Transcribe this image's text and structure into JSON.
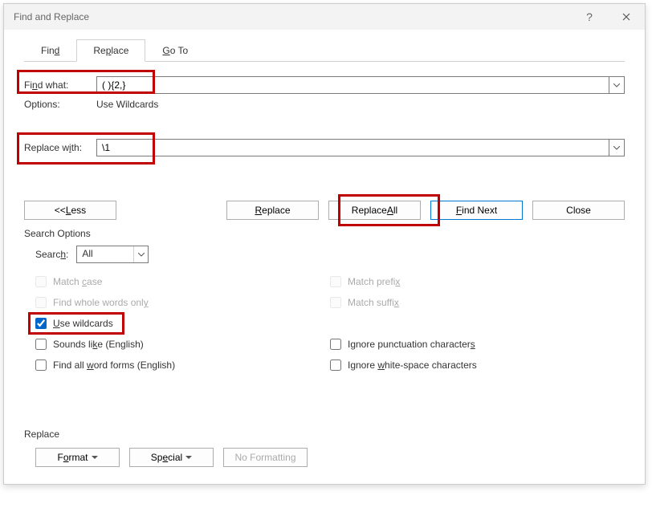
{
  "titlebar": {
    "title": "Find and Replace"
  },
  "tabs": {
    "find": "Find",
    "replace": "Replace",
    "goto": "Go To"
  },
  "labels": {
    "find_what": "Find what:",
    "options": "Options:",
    "options_value": "Use Wildcards",
    "replace_with": "Replace with:"
  },
  "fields": {
    "find_value": "( ){2,}",
    "replace_value": "\\1"
  },
  "buttons": {
    "less": "<< Less",
    "replace": "Replace",
    "replace_all": "Replace All",
    "find_next": "Find Next",
    "close": "Close",
    "format": "Format",
    "special": "Special",
    "no_formatting": "No Formatting"
  },
  "search_options": {
    "legend": "Search Options",
    "search_label": "Search:",
    "search_value": "All",
    "match_case": "Match case",
    "whole_words": "Find whole words only",
    "use_wildcards": "Use wildcards",
    "sounds_like": "Sounds like (English)",
    "all_word_forms": "Find all word forms (English)",
    "match_prefix": "Match prefix",
    "match_suffix": "Match suffix",
    "ignore_punct": "Ignore punctuation characters",
    "ignore_ws": "Ignore white-space characters"
  },
  "bottom": {
    "legend": "Replace"
  }
}
